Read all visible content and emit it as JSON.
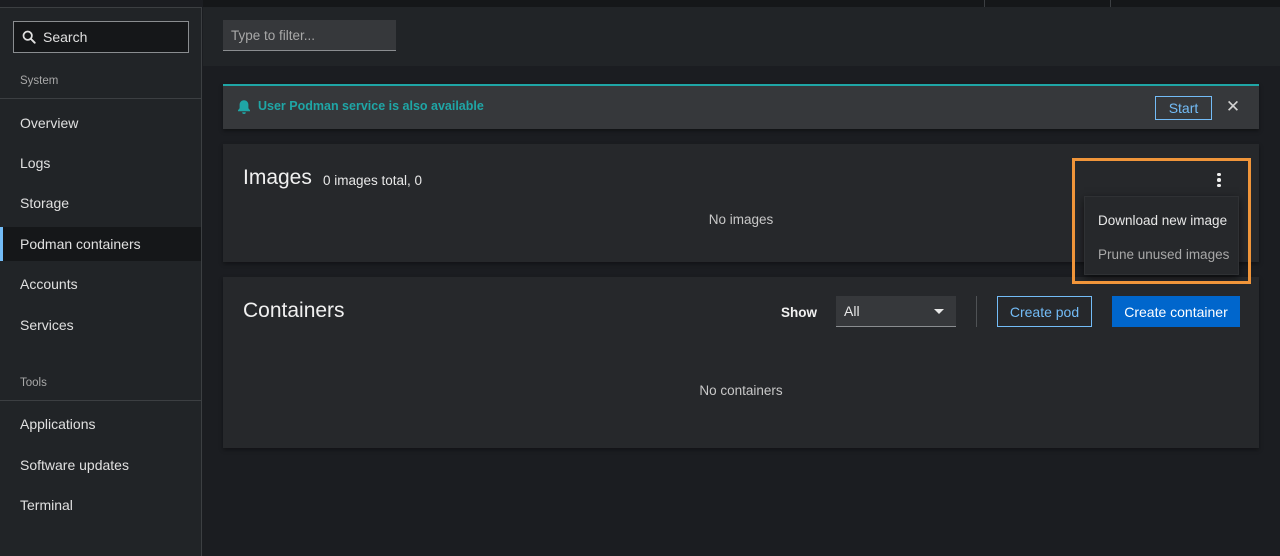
{
  "sidebar": {
    "search_label": "Search",
    "sections": [
      {
        "label": "System",
        "items": [
          {
            "label": "Overview",
            "active": false
          },
          {
            "label": "Logs",
            "active": false
          },
          {
            "label": "Storage",
            "active": false
          },
          {
            "label": "Podman containers",
            "active": true
          },
          {
            "label": "Accounts",
            "active": false
          },
          {
            "label": "Services",
            "active": false
          }
        ]
      },
      {
        "label": "Tools",
        "items": [
          {
            "label": "Applications",
            "active": false
          },
          {
            "label": "Software updates",
            "active": false
          },
          {
            "label": "Terminal",
            "active": false
          }
        ]
      }
    ]
  },
  "filter": {
    "placeholder": "Type to filter..."
  },
  "alert": {
    "title": "User Podman service is also available",
    "start_label": "Start",
    "close_label": "✕",
    "accent_color": "#1fa6a6"
  },
  "images": {
    "title": "Images",
    "count_text": "0 images total, 0",
    "empty_text": "No images",
    "menu": {
      "items": [
        {
          "label": "Download new image",
          "enabled": true
        },
        {
          "label": "Prune unused images",
          "enabled": false
        }
      ]
    }
  },
  "containers": {
    "title": "Containers",
    "show_label": "Show",
    "show_value": "All",
    "create_pod_label": "Create pod",
    "create_container_label": "Create container",
    "empty_text": "No containers"
  },
  "colors": {
    "primary": "#0066cc",
    "link": "#73bcf7",
    "highlight": "#f0953a"
  }
}
